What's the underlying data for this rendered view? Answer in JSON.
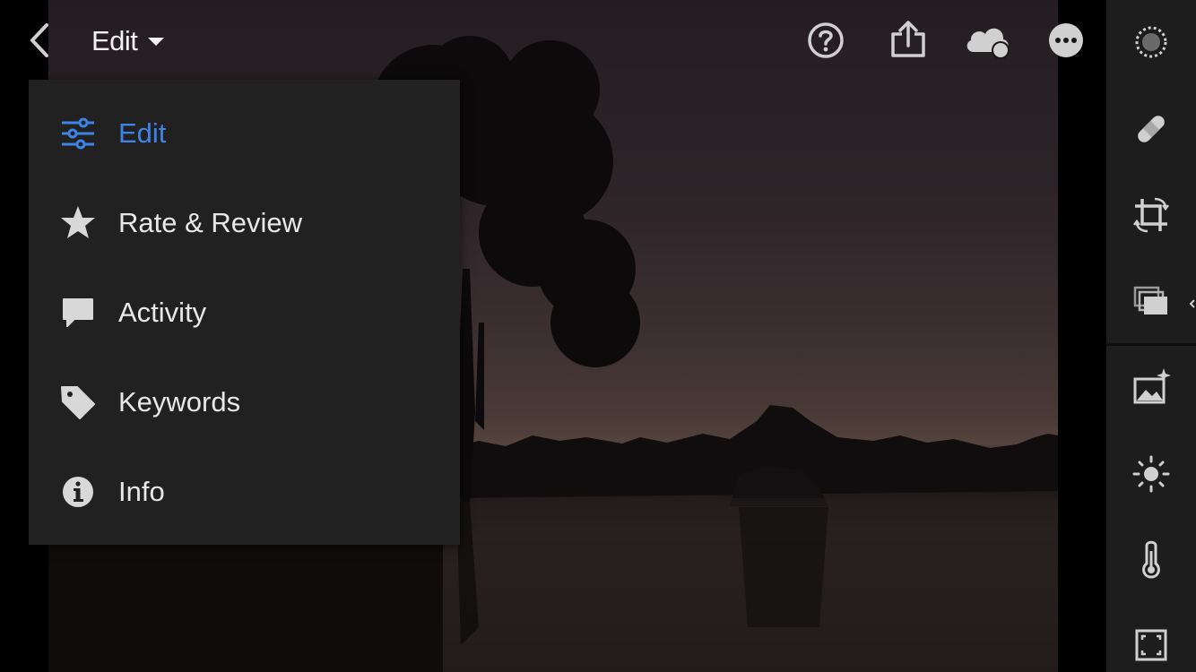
{
  "header": {
    "mode_label": "Edit"
  },
  "icons": {
    "back": "chevron-left-icon",
    "mode_caret": "caret-down-icon",
    "help": "help-icon",
    "share": "share-icon",
    "cloud_sync": "cloud-sync-icon",
    "more": "more-icon"
  },
  "menu": {
    "items": [
      {
        "label": "Edit",
        "icon": "sliders-icon",
        "active": true
      },
      {
        "label": "Rate & Review",
        "icon": "star-icon",
        "active": false
      },
      {
        "label": "Activity",
        "icon": "speech-bubble-icon",
        "active": false
      },
      {
        "label": "Keywords",
        "icon": "tag-icon",
        "active": false
      },
      {
        "label": "Info",
        "icon": "info-icon",
        "active": false
      }
    ]
  },
  "toolbar": {
    "tools": [
      "selective-edit-icon",
      "healing-brush-icon",
      "crop-rotate-icon",
      "presets-icon",
      "auto-enhance-icon",
      "light-icon",
      "color-temperature-icon",
      "effects-icon"
    ]
  },
  "colors": {
    "accent": "#3d84e6",
    "menu_bg": "#212121",
    "toolbar_bg": "#1d1d1d",
    "icon": "#d0d0d0"
  }
}
